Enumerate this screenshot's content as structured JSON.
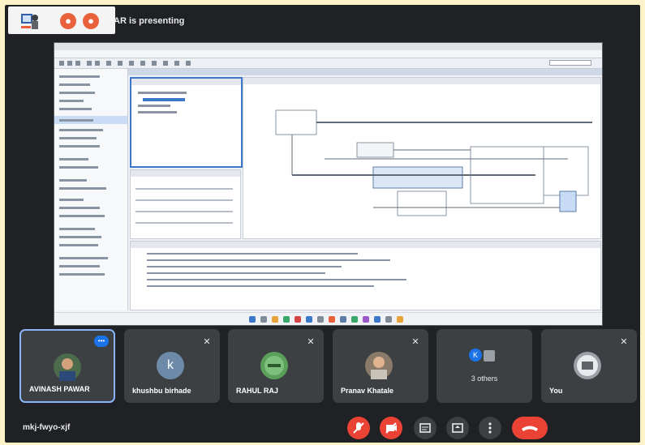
{
  "presentation_banner": "AR is presenting",
  "meeting_code": "mkj-fwyo-xjf",
  "participants": [
    {
      "name": "AVINASH PAWAR",
      "avatar_type": "photo"
    },
    {
      "name": "khushbu birhade",
      "avatar_letter": "k"
    },
    {
      "name": "RAHUL RAJ",
      "avatar_type": "photo"
    },
    {
      "name": "Pranav Khatale",
      "avatar_type": "photo"
    },
    {
      "name": "",
      "others_label": "3 others",
      "avatar_letter": "K"
    },
    {
      "name": "You",
      "avatar_type": "photo"
    }
  ],
  "controls": {
    "mic": "mic-off-icon",
    "camera": "camera-off-icon",
    "captions": "captions-icon",
    "present": "present-icon",
    "more": "more-vertical-icon",
    "end_call": "end-call-icon"
  },
  "colors": {
    "accent": "#1a73e8",
    "danger": "#ea4335",
    "tile_bg": "#3c4043",
    "background": "#202124"
  }
}
